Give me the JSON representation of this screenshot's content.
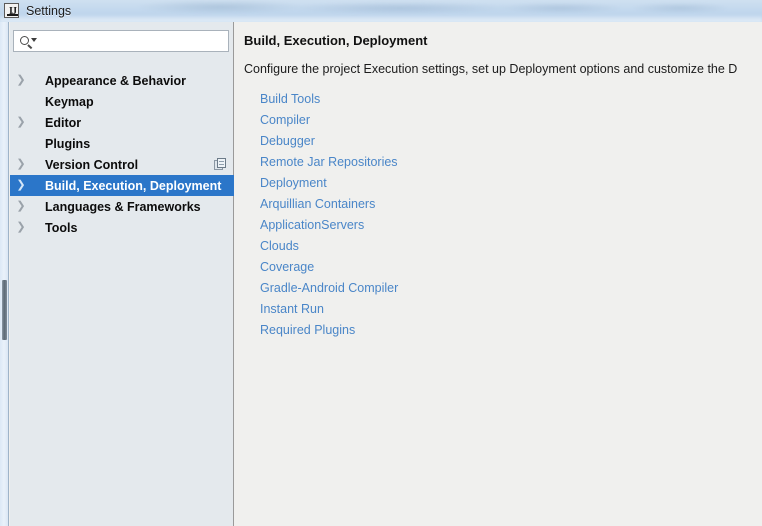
{
  "window": {
    "title": "Settings",
    "icon": "intellij-idea-logo-icon"
  },
  "sidebar": {
    "search": {
      "value": "",
      "placeholder": "",
      "icon": "search-icon",
      "dropdown_icon": "chevron-down-icon"
    },
    "items": [
      {
        "label": "Appearance & Behavior",
        "expandable": true,
        "selected": false,
        "action_icon": ""
      },
      {
        "label": "Keymap",
        "expandable": false,
        "selected": false,
        "action_icon": ""
      },
      {
        "label": "Editor",
        "expandable": true,
        "selected": false,
        "action_icon": ""
      },
      {
        "label": "Plugins",
        "expandable": false,
        "selected": false,
        "action_icon": ""
      },
      {
        "label": "Version Control",
        "expandable": true,
        "selected": false,
        "action_icon": "copy-icon"
      },
      {
        "label": "Build, Execution, Deployment",
        "expandable": true,
        "selected": true,
        "action_icon": ""
      },
      {
        "label": "Languages & Frameworks",
        "expandable": true,
        "selected": false,
        "action_icon": ""
      },
      {
        "label": "Tools",
        "expandable": true,
        "selected": false,
        "action_icon": ""
      }
    ],
    "scrollbar": {
      "name": "vertical-scrollbar"
    }
  },
  "content": {
    "title": "Build, Execution, Deployment",
    "description": "Configure the project Execution settings, set up Deployment options and customize the D",
    "links": [
      "Build Tools",
      "Compiler",
      "Debugger",
      "Remote Jar Repositories",
      "Deployment",
      "Arquillian Containers",
      "ApplicationServers",
      "Clouds",
      "Coverage",
      "Gradle-Android Compiler",
      "Instant Run",
      "Required Plugins"
    ]
  },
  "colors": {
    "selection_blue": "#2b76c9",
    "link_blue": "#4a86c8",
    "sidebar_bg": "#e4e9ed",
    "content_bg": "#f0f0ee",
    "titlebar_blue": "#c4d9ee"
  }
}
